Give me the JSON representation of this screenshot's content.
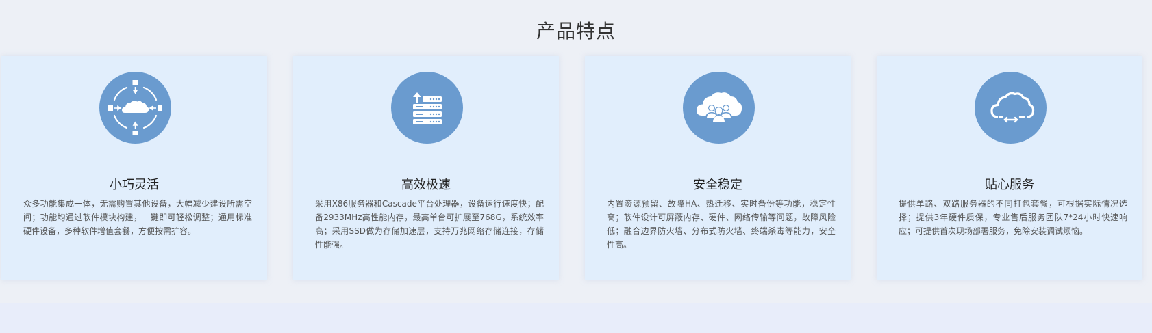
{
  "section": {
    "title": "产品特点",
    "accent_color": "#6a9bcf",
    "card_bg": "#e1eefc"
  },
  "features": [
    {
      "icon": "cloud-network-icon",
      "title": "小巧灵活",
      "desc": "众多功能集成一体，无需购置其他设备，大幅减少建设所需空间；功能均通过软件模块构建，一键即可轻松调整；通用标准硬件设备，多种软件增值套餐，方便按需扩容。"
    },
    {
      "icon": "server-upload-icon",
      "title": "高效极速",
      "desc": "采用X86服务器和Cascade平台处理器，设备运行速度快；配备2933MHz高性能内存，最高单台可扩展至768G，系统效率高；采用SSD做为存储加速层，支持万兆网络存储连接，存储性能强。"
    },
    {
      "icon": "cloud-users-icon",
      "title": "安全稳定",
      "desc": "内置资源预留、故障HA、热迁移、实时备份等功能，稳定性高；软件设计可屏蔽内存、硬件、网络传输等问题，故障风险低；融合边界防火墙、分布式防火墙、终端杀毒等能力，安全性高。"
    },
    {
      "icon": "cloud-sync-icon",
      "title": "贴心服务",
      "desc": "提供单路、双路服务器的不同打包套餐，可根据实际情况选择；提供3年硬件质保，专业售后服务团队7*24小时快速响应；可提供首次现场部署服务，免除安装调试烦恼。"
    }
  ]
}
